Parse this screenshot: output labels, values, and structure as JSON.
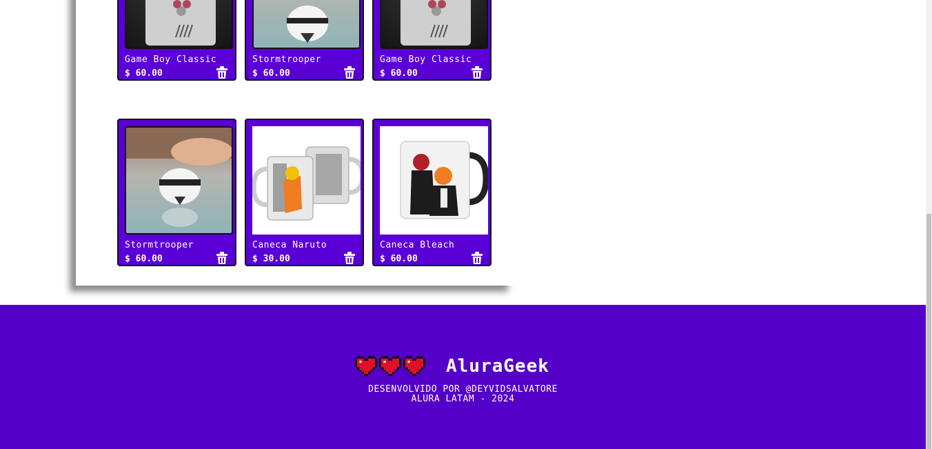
{
  "products": [
    {
      "name": "Game Boy Classic",
      "price": "$ 60.00",
      "image": "gameboy"
    },
    {
      "name": "Stormtrooper",
      "price": "$ 60.00",
      "image": "stormtrooper"
    },
    {
      "name": "Game Boy Classic",
      "price": "$ 60.00",
      "image": "gameboy"
    },
    {
      "name": "Stormtrooper",
      "price": "$ 60.00",
      "image": "stormtrooper"
    },
    {
      "name": "Caneca Naruto",
      "price": "$ 30.00",
      "image": "naruto-mug"
    },
    {
      "name": "Caneca Bleach",
      "price": "$ 60.00",
      "image": "bleach-mug"
    }
  ],
  "icons": {
    "delete": "trash-icon",
    "life": "pixel-heart-icon"
  },
  "footer": {
    "brand": "AluraGeek",
    "credit_line1": "DESENVOLVIDO POR @DEYVIDSALVATORE",
    "credit_line2": "ALURA LATAM - 2024"
  },
  "colors": {
    "card": "#5a00d6",
    "footer": "#5500c8",
    "heart": "#e0102a"
  }
}
